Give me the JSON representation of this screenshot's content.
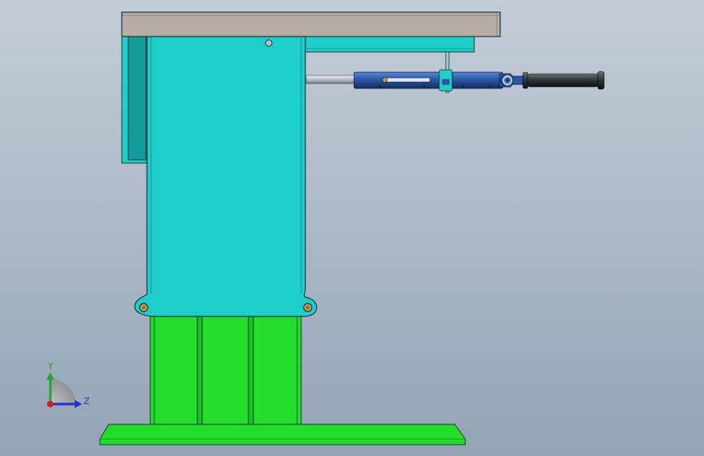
{
  "viewport": {
    "background_top": "#c4cdd8",
    "background_bottom": "#93a4b5"
  },
  "colors": {
    "table_top": "#b7ada6",
    "cyan_body": "#1fcdcb",
    "cyan_dark": "#129b98",
    "green_base": "#24dd2a",
    "blue_handle": "#2b58a9",
    "rod_grey": "#c8ccd6",
    "grip_black": "#2c3236",
    "pin_tan": "#c79d4c",
    "outline": "#1e3a3c",
    "axis_x": "#d21f1f",
    "axis_y": "#28a52c",
    "axis_z": "#2233cc"
  },
  "triad": {
    "y_label": "Y",
    "z_label": "Z"
  }
}
